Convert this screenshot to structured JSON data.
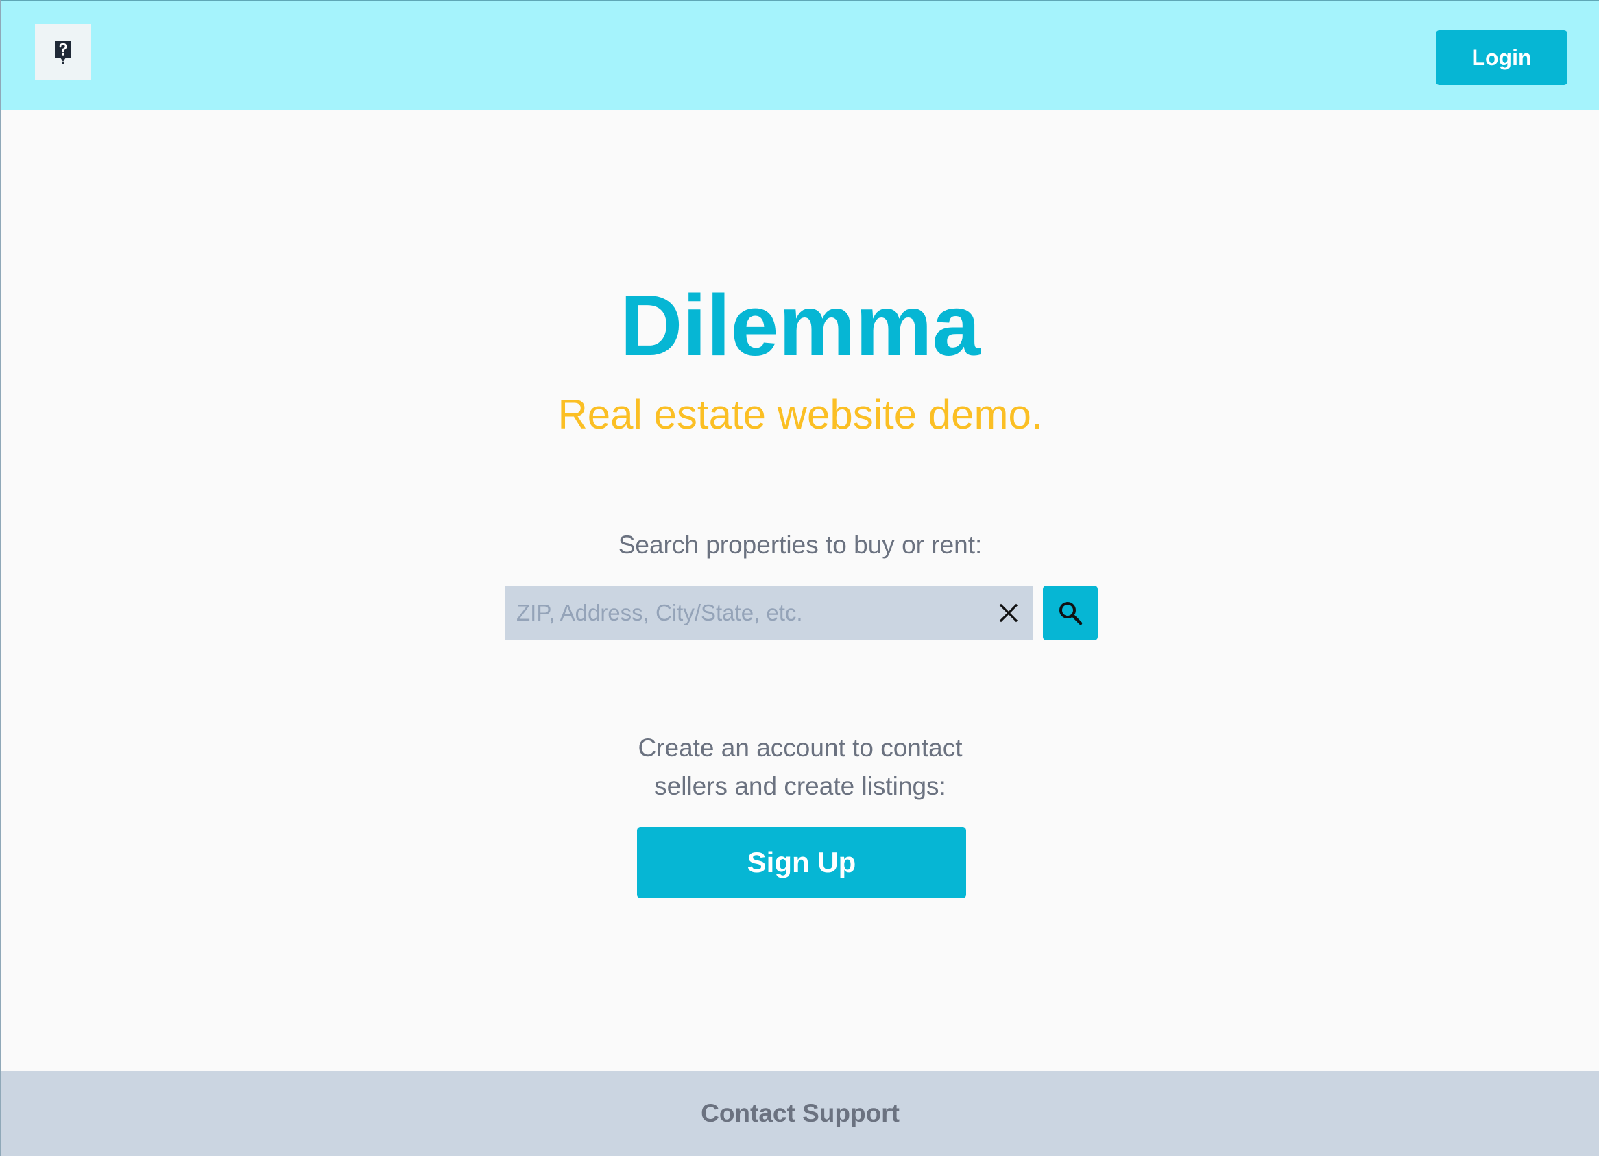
{
  "header": {
    "logo_icon": "house-question-icon",
    "login_label": "Login"
  },
  "hero": {
    "title": "Dilemma",
    "subtitle": "Real estate website demo."
  },
  "search": {
    "label": "Search properties to buy or rent:",
    "placeholder": "ZIP, Address, City/State, etc.",
    "value": "",
    "clear_icon": "close-icon",
    "submit_icon": "search-icon"
  },
  "signup": {
    "prompt_line1": "Create an account to contact",
    "prompt_line2": "sellers and create listings:",
    "button_label": "Sign Up"
  },
  "footer": {
    "contact_label": "Contact Support"
  },
  "colors": {
    "header_bg": "#a5f3fc",
    "accent": "#06b6d4",
    "subtitle": "#fbbf24",
    "muted_text": "#6b7280",
    "input_bg": "#cbd5e1",
    "page_bg": "#fafafa"
  }
}
